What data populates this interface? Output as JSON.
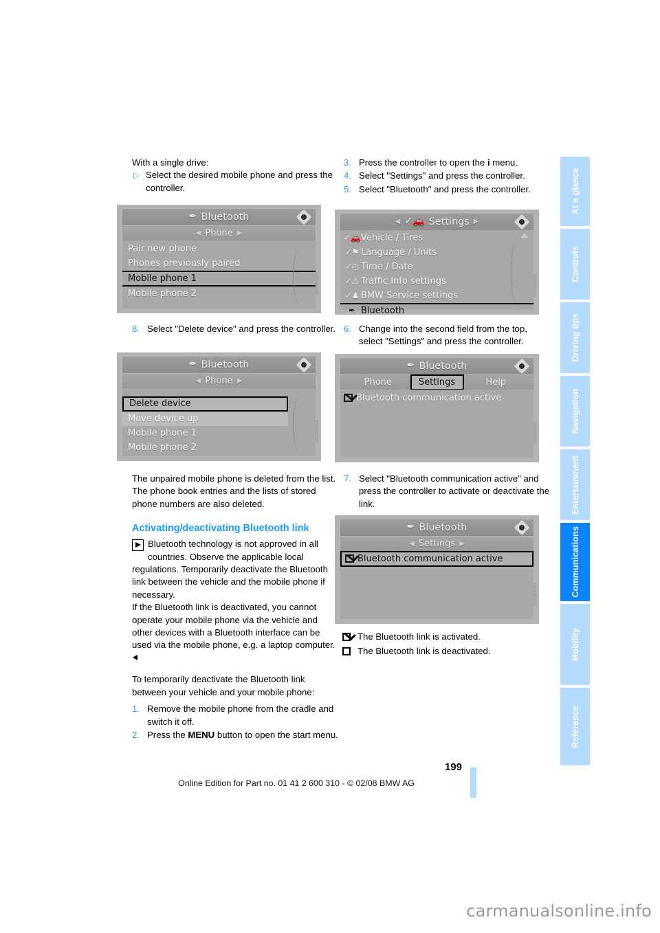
{
  "page": {
    "number": "199",
    "footer_line": "Online Edition for Part no. 01 41 2 600 310 - © 02/08 BMW AG",
    "watermark": "carmanualsonline.info"
  },
  "left_column": {
    "lead_in": "With a single drive:",
    "bullet": {
      "marker": "▷",
      "text": "Select the desired mobile phone and press the controller."
    },
    "step8": {
      "num": "8.",
      "text": "Select \"Delete device\" and press the controller."
    },
    "result_paragraph_1": "The unpaired mobile phone is deleted from the list.",
    "result_paragraph_2": "The phone book entries and the lists of stored phone numbers are also deleted.",
    "section_heading": "Activating/deactivating Bluetooth link",
    "note_text": "Bluetooth technology is not approved in all countries. Observe the applicable local regulations. Temporarily deactivate the Bluetooth link between the vehicle and the mobile phone if necessary.",
    "note_text_2": "If the Bluetooth link is deactivated, you cannot operate your mobile phone via the vehicle and other devices with a Bluetooth interface can be used via the mobile phone, e.g. a laptop computer.",
    "intro_steps": "To temporarily deactivate the Bluetooth link between your vehicle and your mobile phone:",
    "step1": {
      "num": "1.",
      "text": "Remove the mobile phone from the cradle and switch it off."
    },
    "step2": {
      "num": "2.",
      "pre": "Press the ",
      "bold": "MENU",
      "post": " button to open the start menu."
    }
  },
  "right_column": {
    "step3": {
      "num": "3.",
      "pre": "Press the controller to open the ",
      "bold": "i",
      "post": " menu."
    },
    "step4": {
      "num": "4.",
      "text": "Select \"Settings\" and press the controller."
    },
    "step5": {
      "num": "5.",
      "text": "Select \"Bluetooth\" and press the controller."
    },
    "step6": {
      "num": "6.",
      "text": "Change into the second field from the top, select \"Settings\" and press the controller."
    },
    "step7": {
      "num": "7.",
      "text": "Select \"Bluetooth communication active\" and press the controller to activate or deactivate the link."
    },
    "legend": [
      {
        "icon": "checkbox-checked",
        "text": "The Bluetooth link is activated."
      },
      {
        "icon": "checkbox-empty",
        "text": "The Bluetooth link is deactivated."
      }
    ]
  },
  "figures": {
    "fig1": {
      "title": "Bluetooth",
      "title_icon": "bluetooth-icon",
      "subbar": "Phone",
      "rows": [
        {
          "label": "Pair new phone",
          "state": "normal"
        },
        {
          "label": "Phones previously paired",
          "state": "normal"
        },
        {
          "label": "Mobile phone 1",
          "state": "selected"
        },
        {
          "label": "Mobile  phone 2",
          "state": "normal"
        }
      ],
      "code": "VZ5148SM01"
    },
    "fig2": {
      "title": "Settings",
      "title_icon": "vehicle-check-icon",
      "rows": [
        {
          "icon": "vehicle-check-icon",
          "label": "Vehicle / Tires",
          "state": "normal"
        },
        {
          "icon": "flag-check-icon",
          "label": "Language / Units",
          "state": "normal"
        },
        {
          "icon": "clock-check-icon",
          "label": "Time / Date",
          "state": "normal"
        },
        {
          "icon": "warning-check-icon",
          "label": "Traffic Info settings",
          "state": "normal"
        },
        {
          "icon": "service-check-icon",
          "label": "BMW Service settings",
          "state": "normal"
        },
        {
          "icon": "bluetooth-icon",
          "label": "Bluetooth",
          "state": "selected"
        }
      ],
      "code": "VZ5380SM01"
    },
    "fig3": {
      "title": "Bluetooth",
      "title_icon": "bluetooth-icon",
      "subbar": "Phone",
      "rows": [
        {
          "label": "Delete device",
          "state": "boxed"
        },
        {
          "label": "Move device up",
          "state": "light"
        },
        {
          "label": "Mobile phone 1",
          "state": "normal"
        },
        {
          "label": "Mobile phone 2",
          "state": "normal"
        }
      ],
      "code": "VZ5150SM01"
    },
    "fig4": {
      "title": "Bluetooth",
      "title_icon": "bluetooth-icon",
      "tabs": [
        {
          "label": "Phone",
          "state": "normal"
        },
        {
          "label": "Settings",
          "state": "selected"
        },
        {
          "label": "Help",
          "state": "normal"
        }
      ],
      "rows": [
        {
          "label": "Bluetooth communication active",
          "checkbox": true,
          "state": "normal"
        }
      ],
      "code": "VZ5384SM01"
    },
    "fig5": {
      "title": "Bluetooth",
      "title_icon": "bluetooth-icon",
      "subbar": "Settings",
      "rows": [
        {
          "label": "Bluetooth communication active",
          "checkbox": true,
          "state": "boxed"
        }
      ],
      "code": "VZ5385SM01"
    }
  },
  "rail": {
    "tabs": [
      {
        "label": "At a glance",
        "active": false
      },
      {
        "label": "Controls",
        "active": false
      },
      {
        "label": "Driving tips",
        "active": false
      },
      {
        "label": "Navigation",
        "active": false
      },
      {
        "label": "Entertainment",
        "active": false
      },
      {
        "label": "Communications",
        "active": true
      },
      {
        "label": "Mobility",
        "active": false
      },
      {
        "label": "Reference",
        "active": false
      }
    ]
  },
  "colors": {
    "accent_blue": "#1a9bff",
    "rail_inactive": "#b3daff",
    "rail_active": "#0a84ff",
    "screen_gray": "#a8a8a8"
  }
}
